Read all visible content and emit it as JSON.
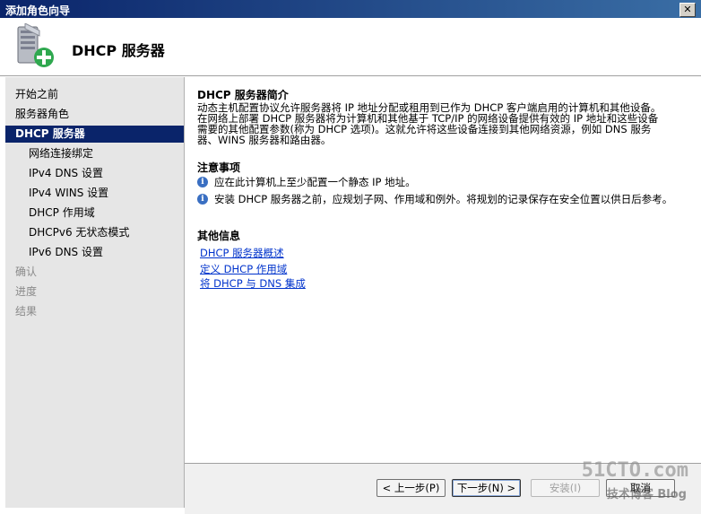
{
  "window": {
    "title": "添加角色向导",
    "close_glyph": "✕"
  },
  "header": {
    "title": "DHCP 服务器",
    "icon": "server-add-icon"
  },
  "nav": {
    "items": [
      {
        "label": "开始之前",
        "state": "normal",
        "level": 0
      },
      {
        "label": "服务器角色",
        "state": "normal",
        "level": 0
      },
      {
        "label": "DHCP 服务器",
        "state": "selected",
        "level": 0
      },
      {
        "label": "网络连接绑定",
        "state": "normal",
        "level": 1
      },
      {
        "label": "IPv4 DNS 设置",
        "state": "normal",
        "level": 1
      },
      {
        "label": "IPv4 WINS 设置",
        "state": "normal",
        "level": 1
      },
      {
        "label": "DHCP 作用域",
        "state": "normal",
        "level": 1
      },
      {
        "label": "DHCPv6 无状态模式",
        "state": "normal",
        "level": 1
      },
      {
        "label": "IPv6 DNS 设置",
        "state": "normal",
        "level": 1
      },
      {
        "label": "确认",
        "state": "disabled",
        "level": 0
      },
      {
        "label": "进度",
        "state": "disabled",
        "level": 0
      },
      {
        "label": "结果",
        "state": "disabled",
        "level": 0
      }
    ]
  },
  "content": {
    "intro_title": "DHCP 服务器简介",
    "intro_lines": [
      "动态主机配置协议允许服务器将 IP 地址分配或租用到已作为 DHCP 客户端启用的计算机和其他设备。",
      "在网络上部署 DHCP 服务器将为计算机和其他基于 TCP/IP 的网络设备提供有效的 IP 地址和这些设备",
      "需要的其他配置参数(称为 DHCP 选项)。这就允许将这些设备连接到其他网络资源，例如 DNS 服务",
      "器、WINS 服务器和路由器。"
    ],
    "notes_title": "注意事项",
    "notes": [
      "应在此计算机上至少配置一个静态 IP 地址。",
      "安装 DHCP 服务器之前，应规划子网、作用域和例外。将规划的记录保存在安全位置以供日后参考。"
    ],
    "info_title": "其他信息",
    "links": [
      "DHCP 服务器概述",
      "定义 DHCP 作用域",
      "将 DHCP 与 DNS 集成"
    ]
  },
  "buttons": {
    "prev": "< 上一步(P)",
    "next": "下一步(N) >",
    "install": "安装(I)",
    "cancel": "取消"
  },
  "watermark": {
    "site": "51CTO.com",
    "sub": "技术博客 Blog"
  },
  "colors": {
    "selection": "#0a246a",
    "link": "#0033cc",
    "left_pane": "#e6e6e6"
  }
}
